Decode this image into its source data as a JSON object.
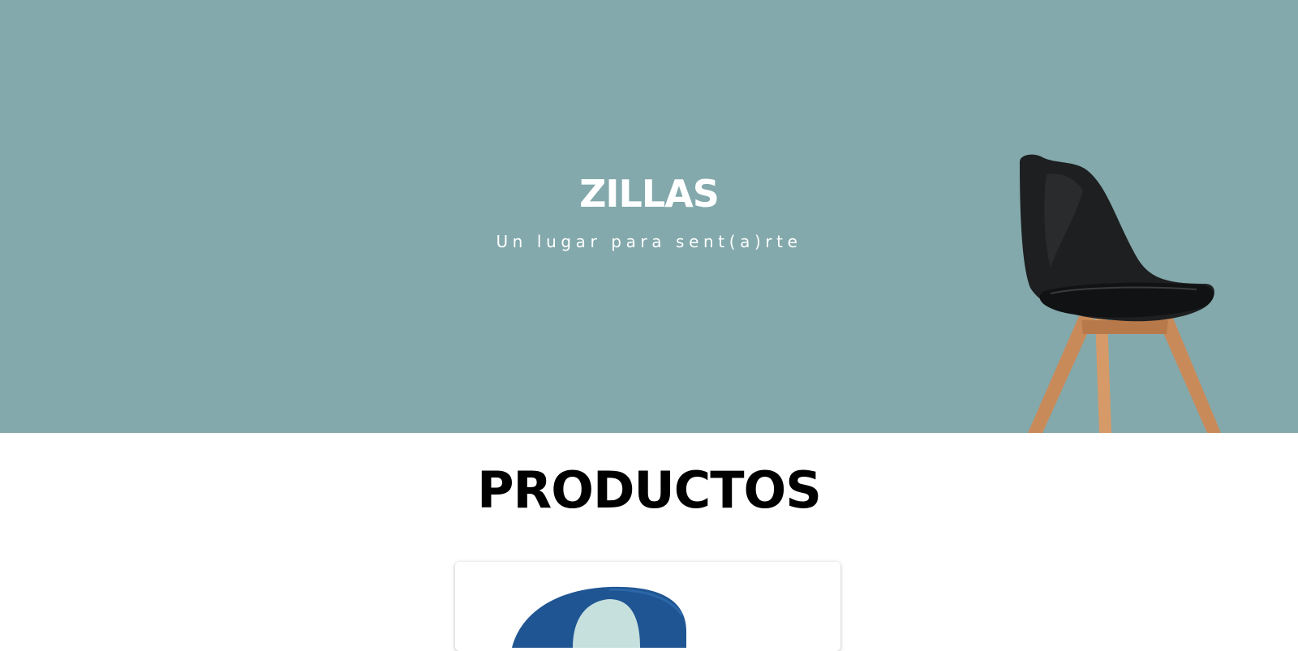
{
  "hero": {
    "brand": "ZILLAS",
    "tagline": "Un lugar para sent(a)rte",
    "background_color": "#83a9ac",
    "image_icon": "chair-illustration"
  },
  "products": {
    "heading": "PRODUCTOS",
    "cards": [
      {
        "image_icon": "armchair-illustration"
      }
    ]
  }
}
